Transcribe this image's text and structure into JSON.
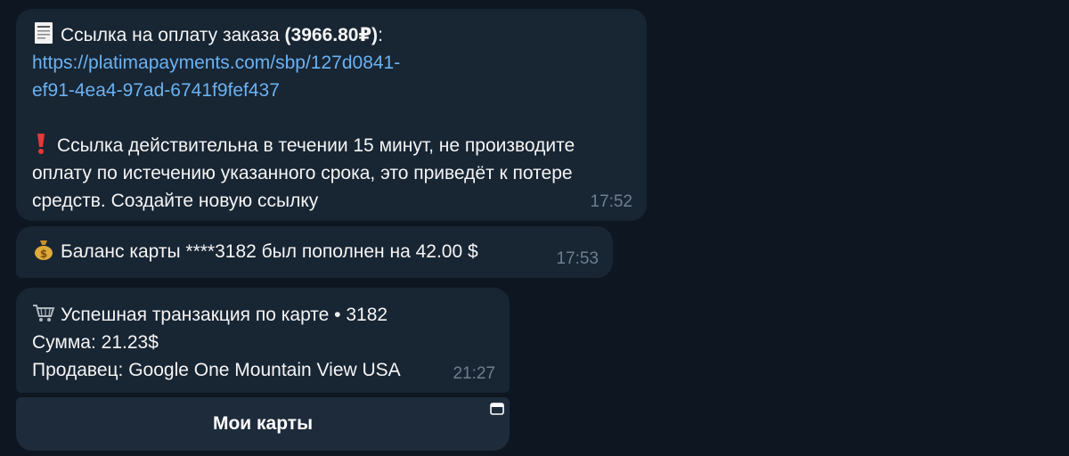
{
  "messages": [
    {
      "icon": "receipt-icon",
      "title_prefix": "Ссылка на оплату заказа ",
      "amount": "(3966.80₽)",
      "title_suffix": ":",
      "link_line1": "https://platimapayments.com/sbp/127d0841-",
      "link_line2": "ef91-4ea4-97ad-6741f9fef437",
      "warning_icon": "exclamation-icon",
      "warning_line1": "Ссылка действительна в течении 15 минут, не производите",
      "warning_line2": "оплату по истечению указанного срока, это приведёт к потере",
      "warning_line3": "средств. Создайте новую ссылку",
      "time": "17:52"
    },
    {
      "icon": "money-bag-icon",
      "text": "Баланс карты ****3182 был пополнен на 42.00 $",
      "time": "17:53"
    },
    {
      "icon": "shopping-cart-icon",
      "line1": "Успешная транзакция по карте • 3182",
      "line2": "Сумма: 21.23$",
      "line3": "Продавец: Google One Mountain View USA",
      "time": "21:27"
    }
  ],
  "keyboard": {
    "button_label": "Мои карты",
    "button_icon": "open-window-icon"
  },
  "colors": {
    "background": "#0e1621",
    "bubble": "#182533",
    "link": "#6ab2f2",
    "time": "#6d7f8f",
    "button": "#1d2b3a"
  }
}
